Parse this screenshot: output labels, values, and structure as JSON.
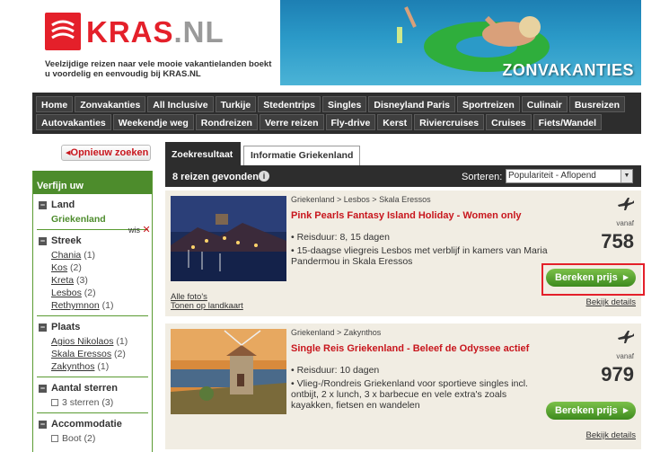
{
  "header": {
    "logo_brand": "KRAS",
    "logo_suffix": ".NL",
    "tagline": "Veelzijdige reizen naar vele mooie vakantielanden boekt u voordelig en eenvoudig bij KRAS.NL",
    "banner_title": "ZONVAKANTIES"
  },
  "nav": {
    "row1": [
      "Home",
      "Zonvakanties",
      "All Inclusive",
      "Turkije",
      "Stedentrips",
      "Singles",
      "Disneyland Paris",
      "Sportreizen",
      "Culinair",
      "Busreizen"
    ],
    "row2": [
      "Autovakanties",
      "Weekendje weg",
      "Rondreizen",
      "Verre reizen",
      "Fly-drive",
      "Kerst",
      "Riviercruises",
      "Cruises",
      "Fiets/Wandel"
    ]
  },
  "sidebar": {
    "new_search_label": "◂Opnieuw zoeken",
    "title": "Verfijn uw zoekresultaat",
    "land": {
      "title": "Land",
      "selected": "Griekenland",
      "clear_label": "wis"
    },
    "streek": {
      "title": "Streek",
      "items": [
        {
          "name": "Chania",
          "count": "(1)"
        },
        {
          "name": "Kos",
          "count": "(2)"
        },
        {
          "name": "Kreta",
          "count": "(3)"
        },
        {
          "name": "Lesbos",
          "count": "(2)"
        },
        {
          "name": "Rethymnon",
          "count": "(1)"
        }
      ]
    },
    "plaats": {
      "title": "Plaats",
      "items": [
        {
          "name": "Agios Nikolaos",
          "count": "(1)"
        },
        {
          "name": "Skala Eressos",
          "count": "(2)"
        },
        {
          "name": "Zakynthos",
          "count": "(1)"
        }
      ]
    },
    "sterren": {
      "title": "Aantal sterren",
      "items": [
        {
          "name": "3 sterren",
          "count": "(3)"
        }
      ]
    },
    "accommodatie": {
      "title": "Accommodatie",
      "items": [
        {
          "name": "Boot",
          "count": "(2)"
        }
      ]
    }
  },
  "main": {
    "tab_active": "Zoekresultaat",
    "tab_inactive": "Informatie Griekenland",
    "found_text": "8 reizen gevonden",
    "sort_label": "Sorteren:",
    "sort_value": "Populariteit - Aflopend",
    "results": [
      {
        "breadcrumb": "Griekenland > Lesbos > Skala Eressos",
        "title": "Pink Pearls Fantasy Island Holiday - Women only",
        "duration": "• Reisduur: 8, 15 dagen",
        "description": "• 15-daagse vliegreis Lesbos met verblijf in kamers van Maria Pandermou in Skala Eressos",
        "vanaf": "vanaf",
        "price": "758",
        "calc_label": "Bereken prijs",
        "photos_link": "Alle foto's",
        "map_link": "Tonen op landkaart",
        "details_link": "Bekijk details"
      },
      {
        "breadcrumb": "Griekenland > Zakynthos",
        "title": "Single Reis Griekenland - Beleef de Odyssee actief",
        "duration": "• Reisduur: 10 dagen",
        "description": "• Vlieg-/Rondreis Griekenland voor sportieve singles incl. ontbijt, 2 x lunch, 3 x barbecue en vele extra's zoals kayakken, fietsen en wandelen",
        "vanaf": "vanaf",
        "price": "979",
        "calc_label": "Bereken prijs",
        "details_link": "Bekijk details"
      }
    ]
  }
}
